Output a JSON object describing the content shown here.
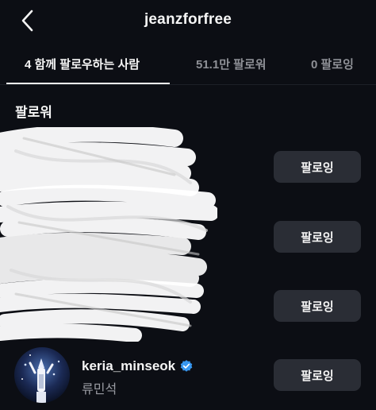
{
  "header": {
    "title": "jeanzforfree"
  },
  "tabs": [
    {
      "label": "4 함께 팔로우하는 사람",
      "active": true
    },
    {
      "label": "51.1만 팔로워",
      "active": false
    },
    {
      "label": "0 팔로잉",
      "active": false
    }
  ],
  "section_label": "팔로워",
  "rows": [
    {
      "button_label": "팔로잉"
    },
    {
      "button_label": "팔로잉"
    },
    {
      "button_label": "팔로잉"
    },
    {
      "username": "keria_minseok",
      "full_name": "류민석",
      "button_label": "팔로잉",
      "verified": true
    }
  ],
  "colors": {
    "background": "#0c0e14",
    "button": "#2a2d35",
    "verified": "#3797f0",
    "muted_text": "#8e9096"
  },
  "icons": {
    "back": "chevron-left-icon",
    "verified": "verified-badge-icon"
  }
}
